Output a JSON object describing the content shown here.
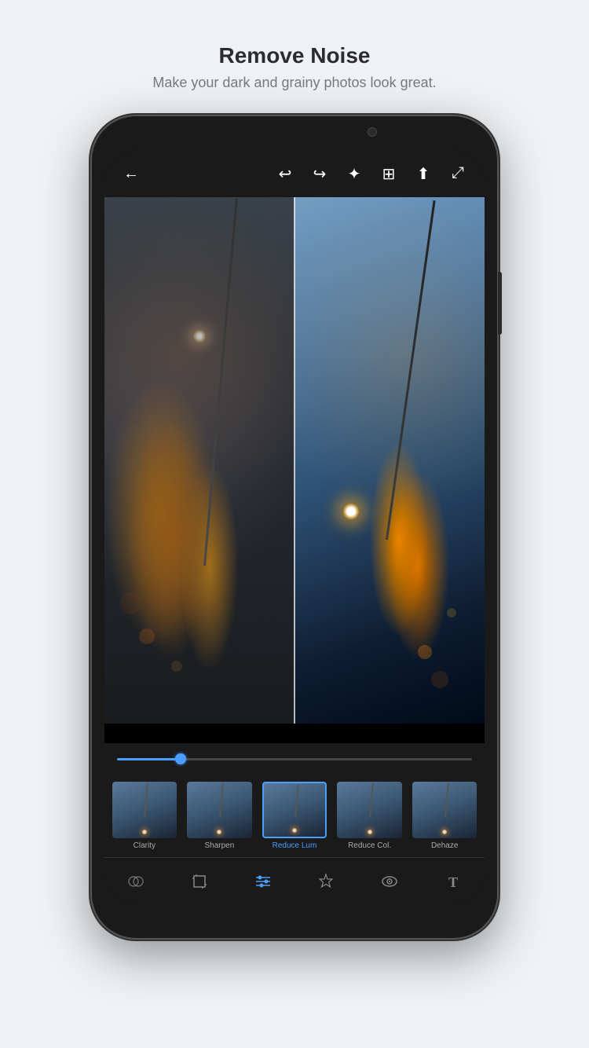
{
  "header": {
    "title": "Remove Noise",
    "subtitle": "Make your dark and grainy photos look great."
  },
  "toolbar": {
    "back_icon": "←",
    "undo_icon": "↩",
    "redo_icon": "↪",
    "wand_icon": "✦",
    "compare_icon": "⊞",
    "share_icon": "⬆",
    "expand_icon": "⤢"
  },
  "slider": {
    "value": 18,
    "max": 100
  },
  "thumbnails": [
    {
      "label": "Clarity",
      "active": false
    },
    {
      "label": "Sharpen",
      "active": false
    },
    {
      "label": "Reduce Lum",
      "active": true
    },
    {
      "label": "Reduce Col.",
      "active": false
    },
    {
      "label": "Dehaze",
      "active": false
    }
  ],
  "bottom_nav": [
    {
      "icon": "⊗",
      "name": "blend-icon",
      "active": false
    },
    {
      "icon": "⊡",
      "name": "crop-icon",
      "active": false
    },
    {
      "icon": "⊟",
      "name": "adjust-icon",
      "active": true
    },
    {
      "icon": "✦",
      "name": "healing-icon",
      "active": false
    },
    {
      "icon": "👁",
      "name": "eye-icon",
      "active": false
    },
    {
      "icon": "T",
      "name": "text-icon",
      "active": false
    }
  ]
}
